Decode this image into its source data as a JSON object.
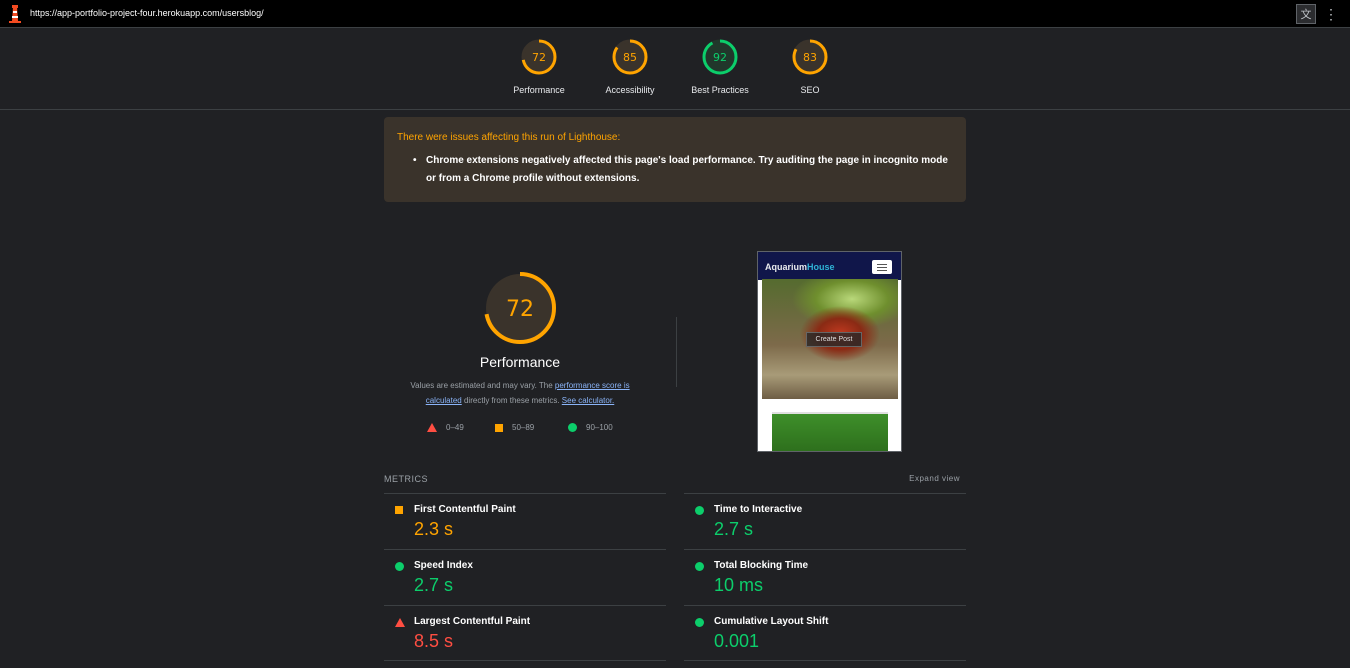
{
  "url_bar": {
    "url": "https://app-portfolio-project-four.herokuapp.com/usersblog/"
  },
  "colors": {
    "pass": "#0cce6b",
    "average": "#ffa400",
    "fail": "#ff4e42"
  },
  "gauges": [
    {
      "label": "Performance",
      "score": 72,
      "status": "average"
    },
    {
      "label": "Accessibility",
      "score": 85,
      "status": "average"
    },
    {
      "label": "Best Practices",
      "score": 92,
      "status": "pass"
    },
    {
      "label": "SEO",
      "score": 83,
      "status": "average"
    }
  ],
  "warning": {
    "title": "There were issues affecting this run of Lighthouse:",
    "items": [
      "Chrome extensions negatively affected this page's load performance. Try auditing the page in incognito mode or from a Chrome profile without extensions."
    ]
  },
  "performance": {
    "score": 72,
    "title": "Performance",
    "desc_prefix": "Values are estimated and may vary. The ",
    "link1": "performance score is calculated",
    "desc_mid": " directly from these metrics. ",
    "link2": "See calculator."
  },
  "legend": [
    {
      "range": "0–49",
      "icon": "triangle"
    },
    {
      "range": "50–89",
      "icon": "square"
    },
    {
      "range": "90–100",
      "icon": "circle"
    }
  ],
  "screenshot": {
    "brand": "Aquarium",
    "brand2": "House",
    "cta": "Create Post"
  },
  "metrics": {
    "title": "METRICS",
    "expand": "Expand view",
    "items": [
      {
        "title": "First Contentful Paint",
        "value": "2.3 s",
        "status": "average"
      },
      {
        "title": "Time to Interactive",
        "value": "2.7 s",
        "status": "pass"
      },
      {
        "title": "Speed Index",
        "value": "2.7 s",
        "status": "pass"
      },
      {
        "title": "Total Blocking Time",
        "value": "10 ms",
        "status": "pass"
      },
      {
        "title": "Largest Contentful Paint",
        "value": "8.5 s",
        "status": "fail"
      },
      {
        "title": "Cumulative Layout Shift",
        "value": "0.001",
        "status": "pass"
      }
    ]
  }
}
